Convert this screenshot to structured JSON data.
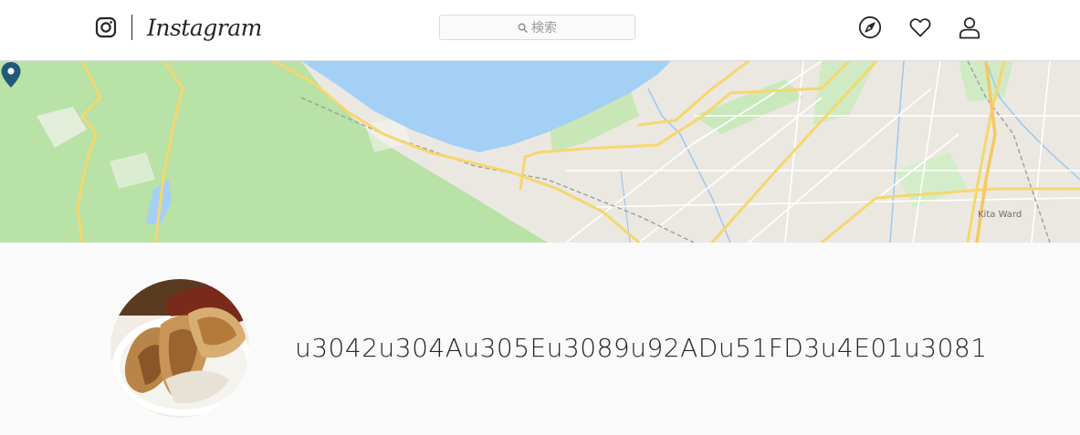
{
  "header": {
    "brand": "Instagram",
    "search": {
      "placeholder": "検索"
    },
    "nav": [
      {
        "name": "explore",
        "icon": "compass-icon"
      },
      {
        "name": "activity",
        "icon": "heart-icon"
      },
      {
        "name": "profile",
        "icon": "person-icon"
      }
    ]
  },
  "map": {
    "district_label": "Kita Ward",
    "marker_icon": "map-pin-icon",
    "colors": {
      "water": "#a4d0f5",
      "park": "#b8e2a6",
      "land": "#ebe8e2",
      "road": "#f5d76e"
    }
  },
  "location": {
    "title": "u3042u304Au305Eu3089u92ADu51FD3u4E01u3081",
    "avatar_subject": "gyoza dumplings photo"
  }
}
